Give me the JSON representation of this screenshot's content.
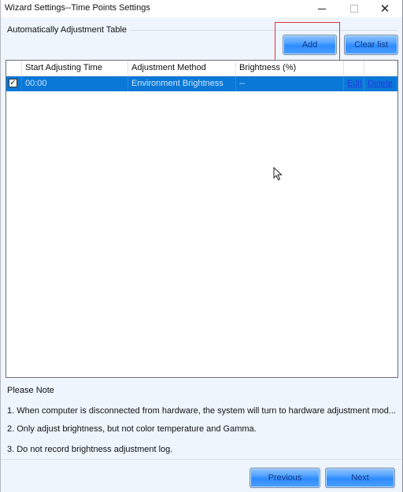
{
  "window": {
    "title": "Wizard Settings--Time Points Settings",
    "minimize_icon": "minimize-icon",
    "maximize_icon": "maximize-icon",
    "close_icon": "close-icon",
    "close_glyph": "✕"
  },
  "group": {
    "label": "Automatically Adjustment Table"
  },
  "toolbar": {
    "add_label": "Add",
    "clear_label": "Clear list"
  },
  "table": {
    "columns": [
      "",
      "Start Adjusting Time",
      "Adjustment Method",
      "Brightness (%)",
      "",
      ""
    ],
    "rows": [
      {
        "checked": true,
        "check_glyph": "✓",
        "time": "00:00",
        "method": "Environment Brightness",
        "brightness": "--",
        "edit_label": "Edit",
        "delete_label": "Delete",
        "selected": true
      }
    ]
  },
  "notes": {
    "heading": "Please Note",
    "items": [
      "1. When computer is disconnected from hardware, the system will turn to hardware adjustment mod...",
      "2. Only adjust brightness, but not color temperature and Gamma.",
      "3. Do not record brightness adjustment log."
    ]
  },
  "footer": {
    "previous_label": "Previous",
    "next_label": "Next"
  },
  "colors": {
    "selection": "#0a78d7",
    "button": "#2d8cff",
    "highlight": "#e0343a",
    "link": "#1f3fe0"
  }
}
